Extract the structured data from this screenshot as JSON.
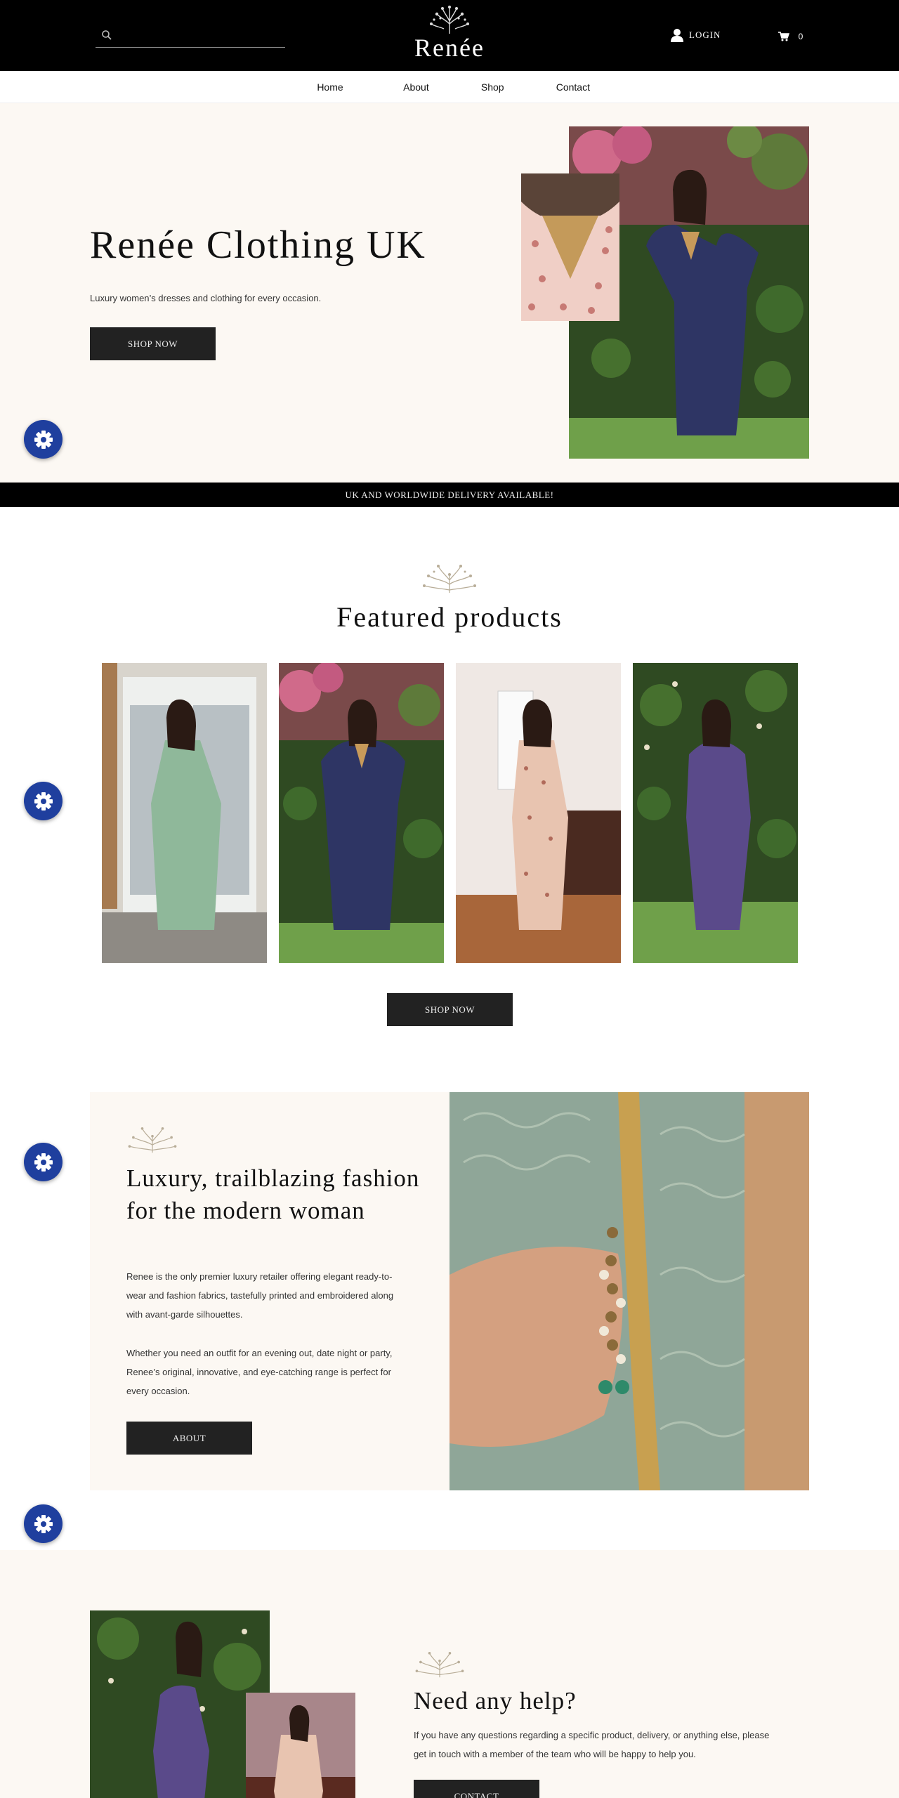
{
  "header": {
    "brand": "Renée",
    "search": {
      "placeholder": "",
      "icon": "search-icon"
    },
    "login_label": "LOGIN",
    "cart_count": "0"
  },
  "nav": {
    "items": [
      "Home",
      "About",
      "Shop",
      "Contact"
    ]
  },
  "hero": {
    "title": "Renée Clothing UK",
    "subtitle": "Luxury women’s dresses and clothing for every occasion.",
    "cta": "SHOP NOW"
  },
  "delivery_banner": "UK AND WORLDWIDE DELIVERY AVAILABLE!",
  "featured": {
    "title": "Featured products",
    "cta": "SHOP NOW",
    "products": [
      {
        "icon": "mint-green-embroidered-dress"
      },
      {
        "icon": "navy-printed-kaftan"
      },
      {
        "icon": "blush-printed-dress"
      },
      {
        "icon": "purple-printed-draped-dress"
      }
    ]
  },
  "luxury": {
    "title": "Luxury, trailblazing fashion for the modern woman",
    "para1": "Renee is the only premier luxury retailer offering elegant ready-to-wear and fashion fabrics, tastefully printed and embroidered along with avant-garde silhouettes.",
    "para2": "Whether you need an outfit for an evening out, date night or party, Renee’s original, innovative, and eye-catching range is perfect for every occasion.",
    "cta": "ABOUT"
  },
  "help": {
    "title": "Need any help?",
    "text": "If you have any questions regarding a specific product, delivery, or anything else, please get in touch with a member of the team who will be happy to help you.",
    "cta": "CONTACT"
  },
  "colors": {
    "header_bg": "#000000",
    "cream": "#fcf8f3",
    "button": "#222222",
    "gear": "#1f3f9e"
  }
}
